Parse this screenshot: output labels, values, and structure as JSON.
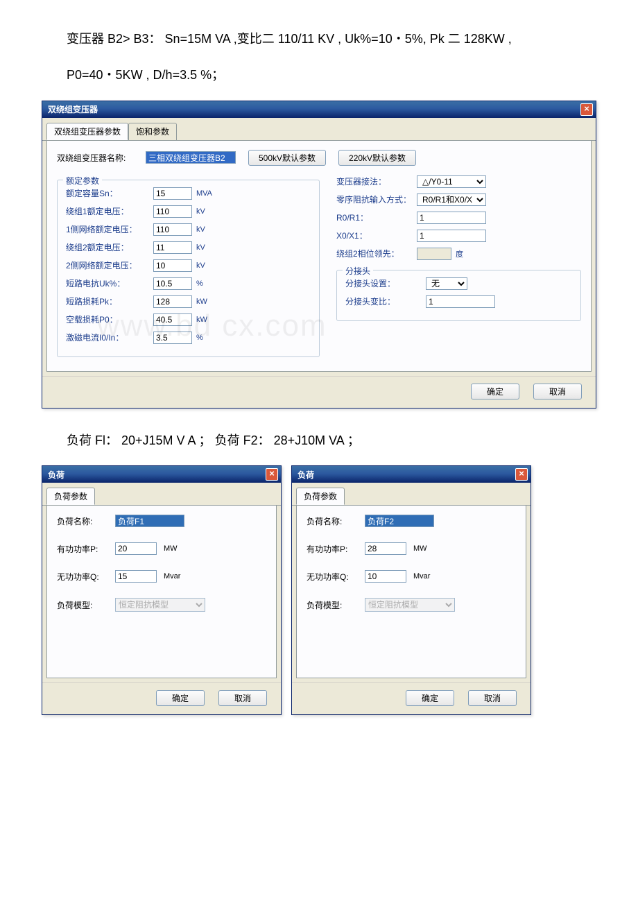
{
  "doc": {
    "line1": "变压器 B2> B3： Sn=15M VA ,变比二 110/11 KV , Uk%=10・5%, Pk 二 128KW ,",
    "line2": "P0=40・5KW , D/h=3.5 %；",
    "line3": "负荷 Fl： 20+J15M V A ； 负荷 F2： 28+J10M VA ；"
  },
  "txf_dialog": {
    "title": "双绕组变压器",
    "tabs": {
      "t1": "双绕组变压器参数",
      "t2": "饱和参数"
    },
    "name_label": "双绕组变压器名称:",
    "name_value": "三相双绕组变压器B2",
    "btn_500kv": "500kV默认参数",
    "btn_220kv": "220kV默认参数",
    "rated_legend": "额定参数",
    "left": {
      "sn_label": "额定容量Sn：",
      "sn": "15",
      "sn_unit": "MVA",
      "w1v_label": "绕组1额定电压：",
      "w1v": "110",
      "w1v_unit": "kV",
      "n1v_label": "1侧网络额定电压：",
      "n1v": "110",
      "n1v_unit": "kV",
      "w2v_label": "绕组2额定电压：",
      "w2v": "11",
      "w2v_unit": "kV",
      "n2v_label": "2侧网络额定电压：",
      "n2v": "10",
      "n2v_unit": "kV",
      "uk_label": "短路电抗Uk%：",
      "uk": "10.5",
      "uk_unit": "%",
      "pk_label": "短路损耗Pk：",
      "pk": "128",
      "pk_unit": "kW",
      "p0_label": "空载损耗P0：",
      "p0": "40.5",
      "p0_unit": "kW",
      "i0_label": "激磁电流I0/In：",
      "i0": "3.5",
      "i0_unit": "%"
    },
    "right": {
      "conn_label": "变压器接法：",
      "conn": "△/Y0-11",
      "zero_label": "零序阻抗输入方式：",
      "zero": "R0/R1和X0/X1",
      "r0r1_label": "R0/R1：",
      "r0r1": "1",
      "x0x1_label": "X0/X1：",
      "x0x1": "1",
      "lead_label": "绕组2相位领先：",
      "lead": "",
      "lead_unit": "度",
      "tap_legend": "分接头",
      "tap_set_label": "分接头设置：",
      "tap_set": "无",
      "tap_ratio_label": "分接头变比：",
      "tap_ratio": "1"
    },
    "ok": "确定",
    "cancel": "取消"
  },
  "load_f1": {
    "title": "负荷",
    "tab": "负荷参数",
    "name_label": "负荷名称:",
    "name": "负荷F1",
    "p_label": "有功功率P:",
    "p": "20",
    "p_unit": "MW",
    "q_label": "无功功率Q:",
    "q": "15",
    "q_unit": "Mvar",
    "model_label": "负荷模型:",
    "model": "恒定阻抗模型",
    "ok": "确定",
    "cancel": "取消"
  },
  "load_f2": {
    "title": "负荷",
    "tab": "负荷参数",
    "name_label": "负荷名称:",
    "name": "负荷F2",
    "p_label": "有功功率P:",
    "p": "28",
    "p_unit": "MW",
    "q_label": "无功功率Q:",
    "q": "10",
    "q_unit": "Mvar",
    "model_label": "负荷模型:",
    "model": "恒定阻抗模型",
    "ok": "确定",
    "cancel": "取消"
  },
  "watermark": "www.bd    cx.com"
}
